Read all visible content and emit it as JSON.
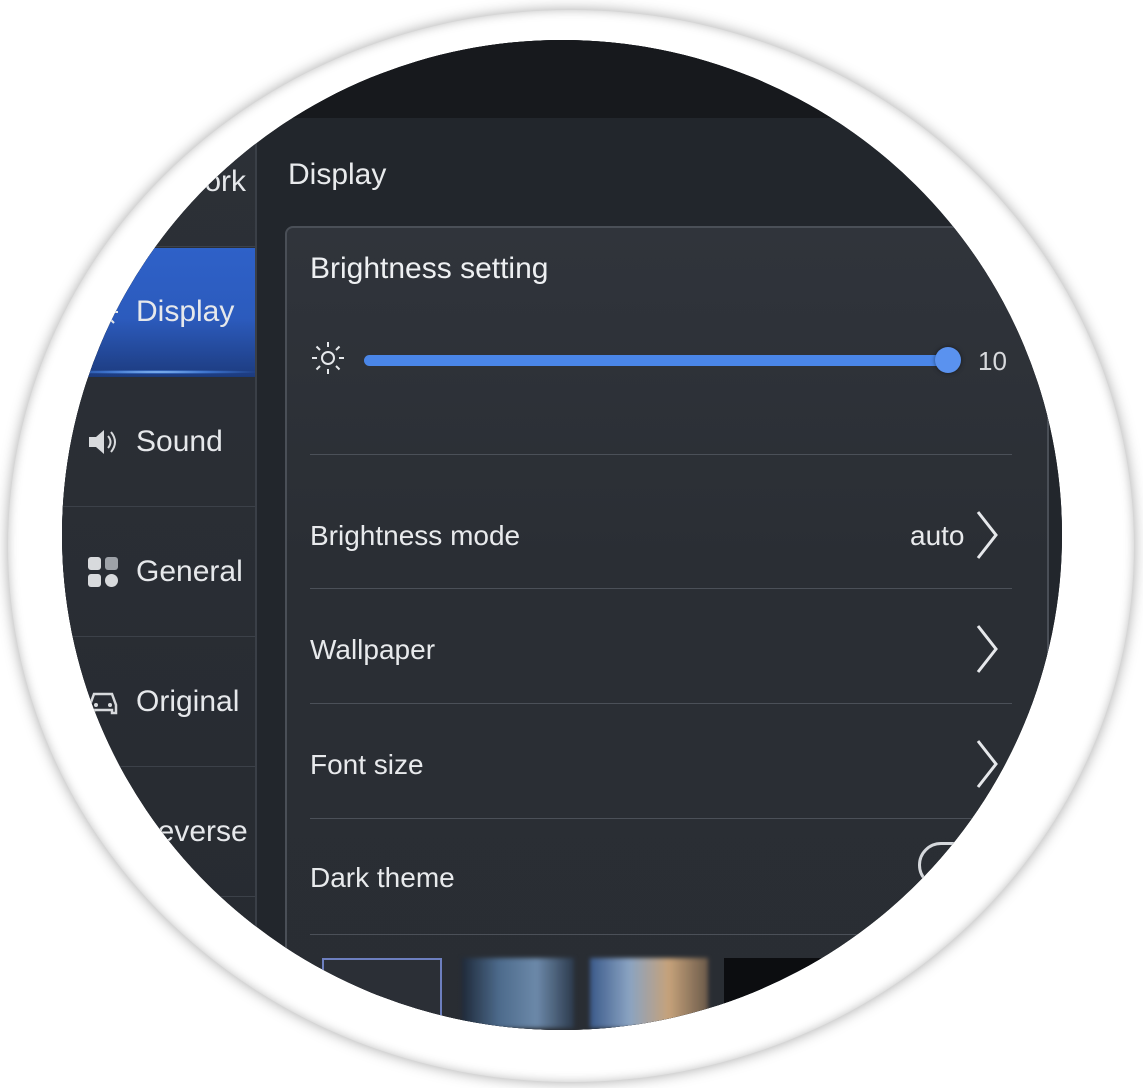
{
  "sidebar": {
    "items": [
      {
        "label": "Network",
        "icon": "network-icon"
      },
      {
        "label": "Display",
        "icon": "brightness-icon",
        "active": true
      },
      {
        "label": "Sound",
        "icon": "speaker-icon"
      },
      {
        "label": "General",
        "icon": "grid-icon"
      },
      {
        "label": "Original",
        "icon": "car-icon"
      },
      {
        "label": "Reverse",
        "icon": "reverse-icon"
      }
    ]
  },
  "main": {
    "title": "Display",
    "brightness": {
      "section_title": "Brightness setting",
      "value": 10,
      "value_label": "10",
      "fraction": 1.0
    },
    "rows": [
      {
        "label": "Brightness mode",
        "value": "auto"
      },
      {
        "label": "Wallpaper"
      },
      {
        "label": "Font size"
      },
      {
        "label": "Dark theme",
        "control": "toggle"
      }
    ]
  },
  "colors": {
    "accent": "#4a86e8",
    "active_sidebar": "#2c5bbd",
    "background": "#22262c"
  }
}
